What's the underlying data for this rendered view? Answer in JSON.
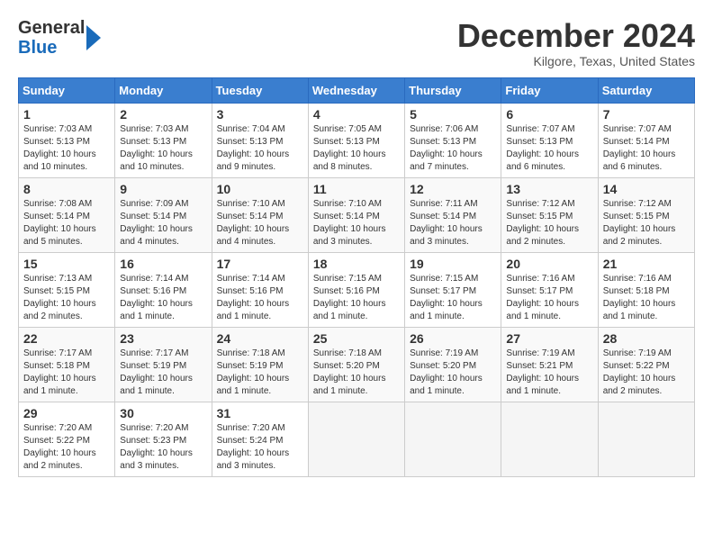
{
  "logo": {
    "general": "General",
    "blue": "Blue"
  },
  "title": "December 2024",
  "location": "Kilgore, Texas, United States",
  "days_of_week": [
    "Sunday",
    "Monday",
    "Tuesday",
    "Wednesday",
    "Thursday",
    "Friday",
    "Saturday"
  ],
  "weeks": [
    [
      {
        "num": "1",
        "sunrise": "7:03 AM",
        "sunset": "5:13 PM",
        "daylight": "10 hours and 10 minutes."
      },
      {
        "num": "2",
        "sunrise": "7:03 AM",
        "sunset": "5:13 PM",
        "daylight": "10 hours and 10 minutes."
      },
      {
        "num": "3",
        "sunrise": "7:04 AM",
        "sunset": "5:13 PM",
        "daylight": "10 hours and 9 minutes."
      },
      {
        "num": "4",
        "sunrise": "7:05 AM",
        "sunset": "5:13 PM",
        "daylight": "10 hours and 8 minutes."
      },
      {
        "num": "5",
        "sunrise": "7:06 AM",
        "sunset": "5:13 PM",
        "daylight": "10 hours and 7 minutes."
      },
      {
        "num": "6",
        "sunrise": "7:07 AM",
        "sunset": "5:13 PM",
        "daylight": "10 hours and 6 minutes."
      },
      {
        "num": "7",
        "sunrise": "7:07 AM",
        "sunset": "5:14 PM",
        "daylight": "10 hours and 6 minutes."
      }
    ],
    [
      {
        "num": "8",
        "sunrise": "7:08 AM",
        "sunset": "5:14 PM",
        "daylight": "10 hours and 5 minutes."
      },
      {
        "num": "9",
        "sunrise": "7:09 AM",
        "sunset": "5:14 PM",
        "daylight": "10 hours and 4 minutes."
      },
      {
        "num": "10",
        "sunrise": "7:10 AM",
        "sunset": "5:14 PM",
        "daylight": "10 hours and 4 minutes."
      },
      {
        "num": "11",
        "sunrise": "7:10 AM",
        "sunset": "5:14 PM",
        "daylight": "10 hours and 3 minutes."
      },
      {
        "num": "12",
        "sunrise": "7:11 AM",
        "sunset": "5:14 PM",
        "daylight": "10 hours and 3 minutes."
      },
      {
        "num": "13",
        "sunrise": "7:12 AM",
        "sunset": "5:15 PM",
        "daylight": "10 hours and 2 minutes."
      },
      {
        "num": "14",
        "sunrise": "7:12 AM",
        "sunset": "5:15 PM",
        "daylight": "10 hours and 2 minutes."
      }
    ],
    [
      {
        "num": "15",
        "sunrise": "7:13 AM",
        "sunset": "5:15 PM",
        "daylight": "10 hours and 2 minutes."
      },
      {
        "num": "16",
        "sunrise": "7:14 AM",
        "sunset": "5:16 PM",
        "daylight": "10 hours and 1 minute."
      },
      {
        "num": "17",
        "sunrise": "7:14 AM",
        "sunset": "5:16 PM",
        "daylight": "10 hours and 1 minute."
      },
      {
        "num": "18",
        "sunrise": "7:15 AM",
        "sunset": "5:16 PM",
        "daylight": "10 hours and 1 minute."
      },
      {
        "num": "19",
        "sunrise": "7:15 AM",
        "sunset": "5:17 PM",
        "daylight": "10 hours and 1 minute."
      },
      {
        "num": "20",
        "sunrise": "7:16 AM",
        "sunset": "5:17 PM",
        "daylight": "10 hours and 1 minute."
      },
      {
        "num": "21",
        "sunrise": "7:16 AM",
        "sunset": "5:18 PM",
        "daylight": "10 hours and 1 minute."
      }
    ],
    [
      {
        "num": "22",
        "sunrise": "7:17 AM",
        "sunset": "5:18 PM",
        "daylight": "10 hours and 1 minute."
      },
      {
        "num": "23",
        "sunrise": "7:17 AM",
        "sunset": "5:19 PM",
        "daylight": "10 hours and 1 minute."
      },
      {
        "num": "24",
        "sunrise": "7:18 AM",
        "sunset": "5:19 PM",
        "daylight": "10 hours and 1 minute."
      },
      {
        "num": "25",
        "sunrise": "7:18 AM",
        "sunset": "5:20 PM",
        "daylight": "10 hours and 1 minute."
      },
      {
        "num": "26",
        "sunrise": "7:19 AM",
        "sunset": "5:20 PM",
        "daylight": "10 hours and 1 minute."
      },
      {
        "num": "27",
        "sunrise": "7:19 AM",
        "sunset": "5:21 PM",
        "daylight": "10 hours and 1 minute."
      },
      {
        "num": "28",
        "sunrise": "7:19 AM",
        "sunset": "5:22 PM",
        "daylight": "10 hours and 2 minutes."
      }
    ],
    [
      {
        "num": "29",
        "sunrise": "7:20 AM",
        "sunset": "5:22 PM",
        "daylight": "10 hours and 2 minutes."
      },
      {
        "num": "30",
        "sunrise": "7:20 AM",
        "sunset": "5:23 PM",
        "daylight": "10 hours and 3 minutes."
      },
      {
        "num": "31",
        "sunrise": "7:20 AM",
        "sunset": "5:24 PM",
        "daylight": "10 hours and 3 minutes."
      },
      null,
      null,
      null,
      null
    ]
  ]
}
